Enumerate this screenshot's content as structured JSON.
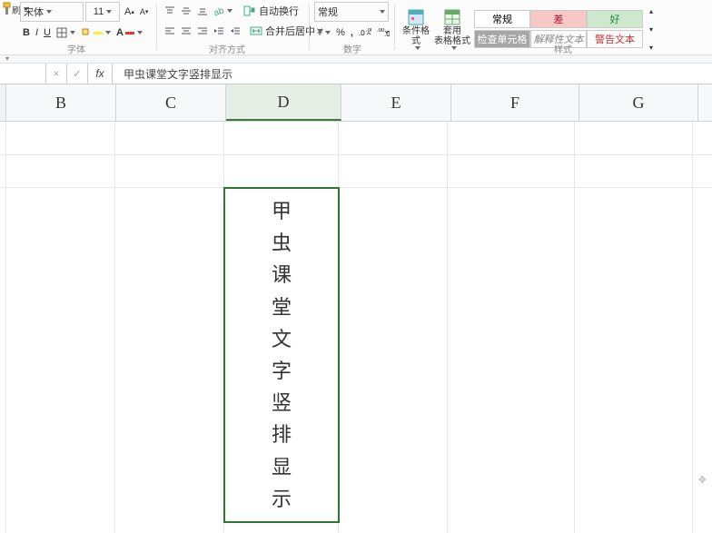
{
  "ribbon": {
    "font_group": {
      "name": "宋体",
      "size": "11",
      "group_label": "字体"
    },
    "bold": "B",
    "italic": "I",
    "underline": "U",
    "align_group": {
      "wrap": "自动换行",
      "merge": "合并后居中",
      "group_label": "对齐方式"
    },
    "number_group": {
      "format": "常规",
      "group_label": "数字"
    },
    "style_group": {
      "cond_fmt": "条件格式",
      "table_fmt": "套用\n表格格式",
      "normal": "常规",
      "bad": "差",
      "good": "好",
      "check": "检查单元格",
      "explain": "解释性文本",
      "warn": "警告文本",
      "group_label": "样式"
    }
  },
  "fbar": {
    "cancel": "×",
    "ok": "✓",
    "fx": "fx",
    "content": "甲虫课堂文字竖排显示"
  },
  "columns": [
    "B",
    "C",
    "D",
    "E",
    "F",
    "G"
  ],
  "cell_text": "甲\n虫\n课\n堂\n文\n字\n竖\n排\n显\n示"
}
